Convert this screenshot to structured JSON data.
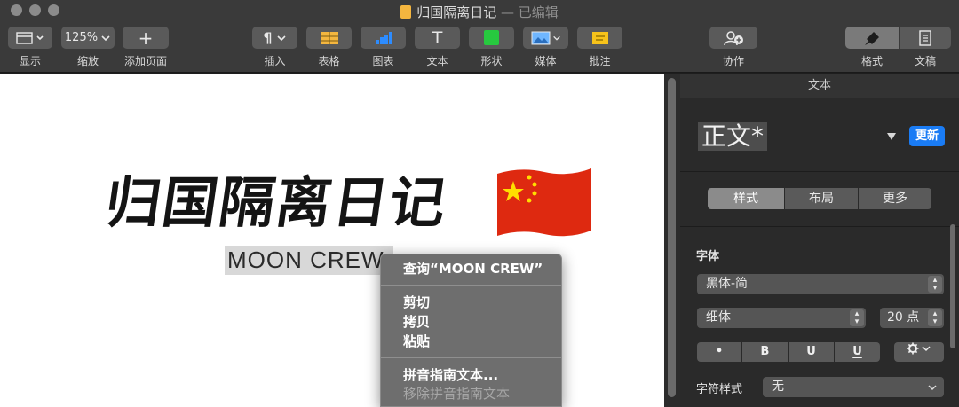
{
  "window": {
    "title": "归国隔离日记",
    "title_suffix": " — 已编辑"
  },
  "toolbar": {
    "view_label": "显示",
    "zoom_value": "125%",
    "zoom_label": "缩放",
    "add_page_label": "添加页面",
    "insert_label": "插入",
    "table_label": "表格",
    "chart_label": "图表",
    "text_label": "文本",
    "shape_label": "形状",
    "media_label": "媒体",
    "comment_label": "批注",
    "collab_label": "协作",
    "format_label": "格式",
    "document_label": "文稿",
    "add_icon": "+",
    "pilcrow_icon": "¶",
    "text_icon": "T"
  },
  "document": {
    "title": "归国隔离日记",
    "subtitle": "MOON CREW"
  },
  "context_menu": {
    "lookup": "查询“MOON CREW”",
    "cut": "剪切",
    "copy": "拷贝",
    "paste": "粘贴",
    "pinyin_guide": "拼音指南文本...",
    "remove_pinyin": "移除拼音指南文本"
  },
  "inspector": {
    "header": "文本",
    "paragraph_style": "正文*",
    "update_button": "更新",
    "tabs": [
      "样式",
      "布局",
      "更多"
    ],
    "font_section": "字体",
    "font_family": "黑体-简",
    "font_weight": "细体",
    "font_size": "20 点",
    "format_buttons": [
      "•",
      "B",
      "U",
      "U"
    ],
    "char_style_label": "字符样式",
    "char_style_value": "无"
  },
  "colors": {
    "accent_blue": "#1a7cf5",
    "toolbar_bg": "#3a3a3a",
    "table_icon": "#f4b63f",
    "shape_icon": "#27c93f",
    "comment_icon": "#f7c31b"
  }
}
